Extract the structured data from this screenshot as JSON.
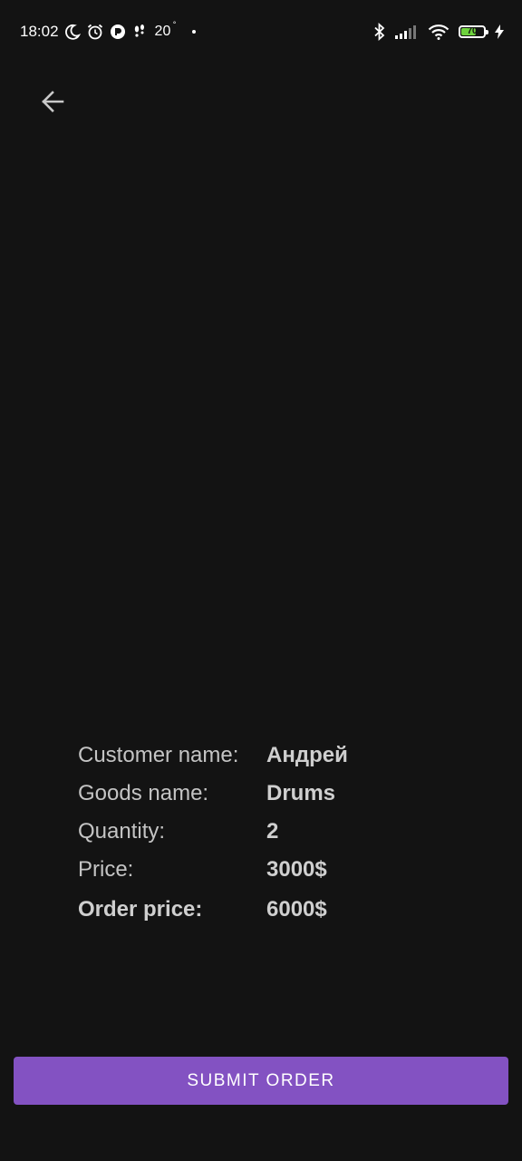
{
  "status_bar": {
    "time": "18:02",
    "temperature": "20",
    "temperature_unit": "°",
    "battery_level": "70",
    "battery_fraction": 0.7,
    "battery_color": "#6fd33e",
    "icons_left": [
      "moon-icon",
      "alarm-icon",
      "app-notification-icon",
      "footsteps-icon"
    ],
    "icons_right": [
      "bluetooth-icon",
      "signal-icon",
      "wifi-icon",
      "battery-icon",
      "charging-icon"
    ]
  },
  "toolbar": {
    "back_icon": "arrow-left-icon"
  },
  "order": {
    "customer_label": "Customer name:",
    "customer_value": "Андрей",
    "goods_label": "Goods name:",
    "goods_value": "Drums",
    "quantity_label": "Quantity:",
    "quantity_value": "2",
    "price_label": "Price:",
    "price_value": "3000$",
    "total_label": "Order price:",
    "total_value": "6000$"
  },
  "actions": {
    "submit_label": "SUBMIT ORDER"
  },
  "colors": {
    "background": "#131313",
    "accent": "#8352c2",
    "text": "#c9c9c9"
  }
}
